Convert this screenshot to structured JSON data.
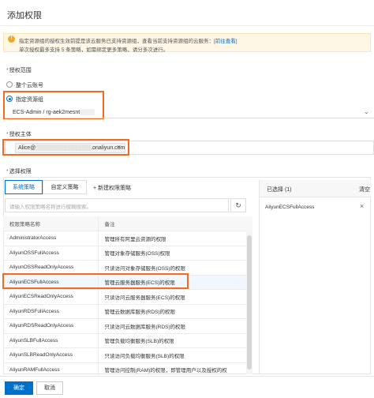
{
  "header": {
    "title": "添加权限"
  },
  "alert": {
    "line1": "指定资源组的授权生效前提是该云服务已支持资源组，查看当前支持资源组的云服务：",
    "link": "[前往查看]",
    "line2": "单次授权最多支持 5 条策略，如需绑定更多策略，请分多次进行。"
  },
  "scope": {
    "label": "授权范围",
    "option_account": "整个云账号",
    "option_group": "指定资源组",
    "group_value": "ECS-Admin / rg-aek2mesnt"
  },
  "principal": {
    "label": "授权主体",
    "tag_prefix": "Alice@",
    "tag_suffix": ".onaliyun.com"
  },
  "policies": {
    "label": "选择权限",
    "tabs": [
      "系统策略",
      "自定义策略"
    ],
    "new_policy_link": "+ 新建权限策略",
    "search_placeholder": "请输入权限策略名称进行模糊搜索。",
    "columns": [
      "权限策略名称",
      "备注"
    ],
    "rows": [
      {
        "name": "AdministratorAccess",
        "note": "管理所有阿里云资源的权限"
      },
      {
        "name": "AliyunOSSFullAccess",
        "note": "管理对象存储服务(OSS)权限"
      },
      {
        "name": "AliyunOSSReadOnlyAccess",
        "note": "只读访问对象存储服务(OSS)的权限"
      },
      {
        "name": "AliyunECSFullAccess",
        "note": "管理云服务器服务(ECS)的权限"
      },
      {
        "name": "AliyunECSReadOnlyAccess",
        "note": "只读访问云服务器服务(ECS)的权限"
      },
      {
        "name": "AliyunRDSFullAccess",
        "note": "管理云数据库服务(RDS)的权限"
      },
      {
        "name": "AliyunRDSReadOnlyAccess",
        "note": "只读访问云数据库服务(RDS)的权限"
      },
      {
        "name": "AliyunSLBFullAccess",
        "note": "管理负载均衡服务(SLB)的权限"
      },
      {
        "name": "AliyunSLBReadOnlyAccess",
        "note": "只读访问负载均衡服务(SLB)的权限"
      },
      {
        "name": "AliyunRAMFullAccess",
        "note": "管理访问控制(RAM)的权限，即管理用户以及授权的权"
      }
    ]
  },
  "selected": {
    "title": "已选择",
    "count": "(1)",
    "clear": "清空",
    "items": [
      "AliyunECSFullAccess"
    ]
  },
  "footer": {
    "confirm": "确定",
    "cancel": "取消"
  },
  "colors": {
    "accent": "#0070cc",
    "highlight": "#f36b20"
  }
}
